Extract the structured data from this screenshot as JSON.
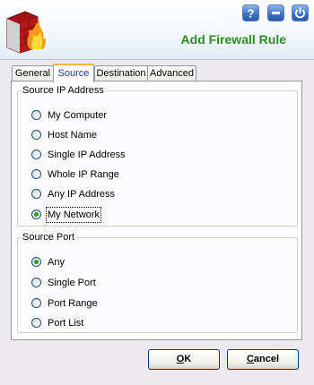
{
  "header": {
    "title": "Add Firewall Rule",
    "help_glyph": "?",
    "icons": [
      "firewall-logo-icon",
      "help-icon",
      "minimize-icon",
      "power-icon"
    ]
  },
  "tabs": [
    {
      "label": "General",
      "active": false
    },
    {
      "label": "Source",
      "active": true
    },
    {
      "label": "Destination",
      "active": false
    },
    {
      "label": "Advanced",
      "active": false
    }
  ],
  "source_ip": {
    "legend": "Source IP Address",
    "options": [
      {
        "label": "My Computer",
        "checked": false
      },
      {
        "label": "Host Name",
        "checked": false
      },
      {
        "label": "Single IP Address",
        "checked": false
      },
      {
        "label": "Whole IP Range",
        "checked": false
      },
      {
        "label": "Any IP Address",
        "checked": false
      },
      {
        "label": "My Network",
        "checked": true
      }
    ]
  },
  "source_port": {
    "legend": "Source Port",
    "options": [
      {
        "label": "Any",
        "checked": true
      },
      {
        "label": "Single Port",
        "checked": false
      },
      {
        "label": "Port Range",
        "checked": false
      },
      {
        "label": "Port List",
        "checked": false
      }
    ]
  },
  "buttons": {
    "ok_mnemonic": "O",
    "ok_rest": "K",
    "cancel_mnemonic": "C",
    "cancel_rest": "ancel"
  },
  "colors": {
    "title_green": "#2e8b26",
    "active_tab_accent": "#f3b33f",
    "radio_dot": "#21a121",
    "header_button_blue": "#3f74c8"
  }
}
